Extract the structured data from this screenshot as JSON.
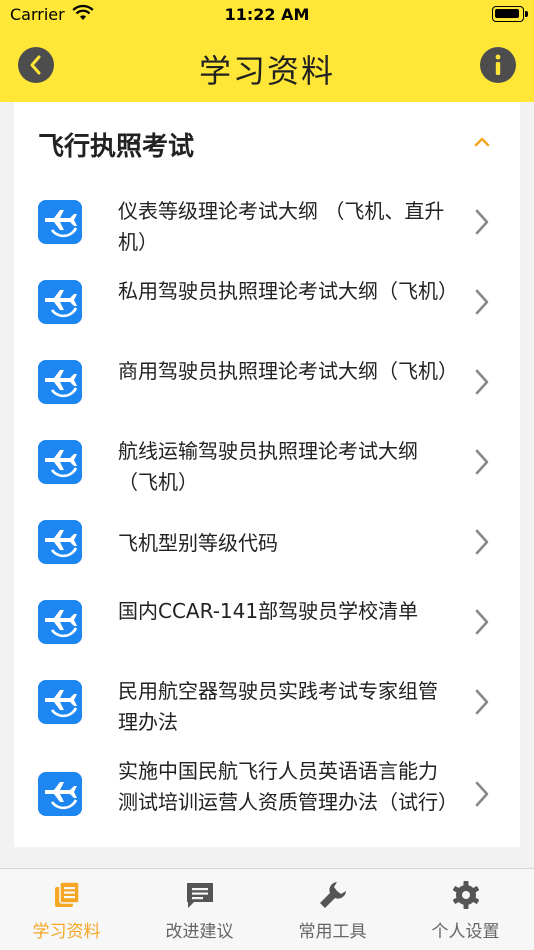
{
  "status_bar": {
    "carrier": "Carrier",
    "time": "11:22 AM"
  },
  "nav": {
    "title": "学习资料"
  },
  "section": {
    "title": "飞行执照考试",
    "items": [
      {
        "label": "仪表等级理论考试大纲 （飞机、直升机）"
      },
      {
        "label": "私用驾驶员执照理论考试大纲（飞机）"
      },
      {
        "label": "商用驾驶员执照理论考试大纲（飞机）"
      },
      {
        "label": "航线运输驾驶员执照理论考试大纲（飞机）"
      },
      {
        "label": "飞机型别等级代码"
      },
      {
        "label": "国内CCAR-141部驾驶员学校清单"
      },
      {
        "label": "民用航空器驾驶员实践考试专家组管理办法"
      },
      {
        "label": "实施中国民航飞行人员英语语言能力测试培训运营人资质管理办法（试行）"
      }
    ]
  },
  "tabs": [
    {
      "label": "学习资料",
      "icon": "book-icon",
      "active": true
    },
    {
      "label": "改进建议",
      "icon": "message-icon",
      "active": false
    },
    {
      "label": "常用工具",
      "icon": "wrench-icon",
      "active": false
    },
    {
      "label": "个人设置",
      "icon": "gear-icon",
      "active": false
    }
  ],
  "colors": {
    "header": "#ffe637",
    "accent": "#f5a623",
    "icon_blue": "#1d86f0"
  }
}
